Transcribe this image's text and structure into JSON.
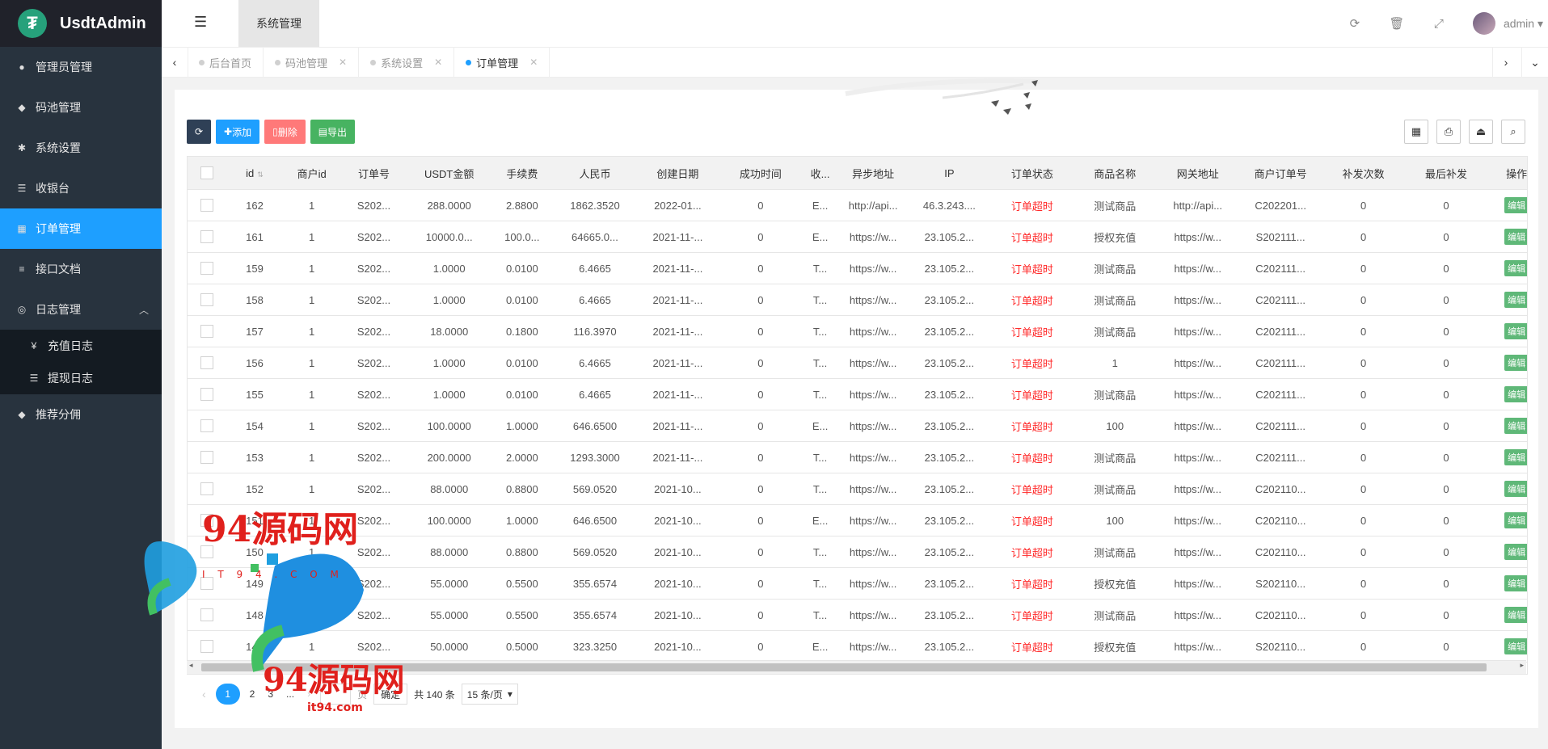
{
  "app": {
    "logo_letter": "₮",
    "title": "UsdtAdmin"
  },
  "sidebar": {
    "items": [
      {
        "label": "管理员管理",
        "icon": "user-icon"
      },
      {
        "label": "码池管理",
        "icon": "android-icon"
      },
      {
        "label": "系统设置",
        "icon": "gear-icon"
      },
      {
        "label": "收银台",
        "icon": "list-icon"
      },
      {
        "label": "订单管理",
        "icon": "calculator-icon",
        "active": true
      },
      {
        "label": "接口文档",
        "icon": "doc-icon"
      },
      {
        "label": "日志管理",
        "icon": "log-icon",
        "expanded": true
      },
      {
        "label": "推荐分佣",
        "icon": "android-icon"
      }
    ],
    "sub_items": [
      {
        "label": "充值日志",
        "glyph": "¥"
      },
      {
        "label": "提现日志",
        "glyph": "☰"
      }
    ]
  },
  "header": {
    "section_tab": "系统管理",
    "user": "admin"
  },
  "tabs": [
    {
      "label": "后台首页",
      "closable": false
    },
    {
      "label": "码池管理",
      "closable": true
    },
    {
      "label": "系统设置",
      "closable": true
    },
    {
      "label": "订单管理",
      "closable": true,
      "active": true
    }
  ],
  "toolbar": {
    "add": "添加",
    "delete": "删除",
    "export": "导出"
  },
  "table": {
    "columns": [
      "id",
      "商户id",
      "订单号",
      "USDT金额",
      "手续费",
      "人民币",
      "创建日期",
      "成功时间",
      "收...",
      "异步地址",
      "IP",
      "订单状态",
      "商品名称",
      "网关地址",
      "商户订单号",
      "补发次数",
      "最后补发",
      "操作"
    ],
    "edit_label": "编辑",
    "rows": [
      [
        "162",
        "1",
        "S202...",
        "288.0000",
        "2.8800",
        "1862.3520",
        "2022-01...",
        "0",
        "E...",
        "http://api...",
        "46.3.243....",
        "订单超时",
        "测试商品",
        "http://api...",
        "C202201...",
        "0",
        "0"
      ],
      [
        "161",
        "1",
        "S202...",
        "10000.0...",
        "100.0...",
        "64665.0...",
        "2021-11-...",
        "0",
        "E...",
        "https://w...",
        "23.105.2...",
        "订单超时",
        "授权充值",
        "https://w...",
        "S202111...",
        "0",
        "0"
      ],
      [
        "159",
        "1",
        "S202...",
        "1.0000",
        "0.0100",
        "6.4665",
        "2021-11-...",
        "0",
        "T...",
        "https://w...",
        "23.105.2...",
        "订单超时",
        "测试商品",
        "https://w...",
        "C202111...",
        "0",
        "0"
      ],
      [
        "158",
        "1",
        "S202...",
        "1.0000",
        "0.0100",
        "6.4665",
        "2021-11-...",
        "0",
        "T...",
        "https://w...",
        "23.105.2...",
        "订单超时",
        "测试商品",
        "https://w...",
        "C202111...",
        "0",
        "0"
      ],
      [
        "157",
        "1",
        "S202...",
        "18.0000",
        "0.1800",
        "116.3970",
        "2021-11-...",
        "0",
        "T...",
        "https://w...",
        "23.105.2...",
        "订单超时",
        "测试商品",
        "https://w...",
        "C202111...",
        "0",
        "0"
      ],
      [
        "156",
        "1",
        "S202...",
        "1.0000",
        "0.0100",
        "6.4665",
        "2021-11-...",
        "0",
        "T...",
        "https://w...",
        "23.105.2...",
        "订单超时",
        "1",
        "https://w...",
        "C202111...",
        "0",
        "0"
      ],
      [
        "155",
        "1",
        "S202...",
        "1.0000",
        "0.0100",
        "6.4665",
        "2021-11-...",
        "0",
        "T...",
        "https://w...",
        "23.105.2...",
        "订单超时",
        "测试商品",
        "https://w...",
        "C202111...",
        "0",
        "0"
      ],
      [
        "154",
        "1",
        "S202...",
        "100.0000",
        "1.0000",
        "646.6500",
        "2021-11-...",
        "0",
        "E...",
        "https://w...",
        "23.105.2...",
        "订单超时",
        "100",
        "https://w...",
        "C202111...",
        "0",
        "0"
      ],
      [
        "153",
        "1",
        "S202...",
        "200.0000",
        "2.0000",
        "1293.3000",
        "2021-11-...",
        "0",
        "T...",
        "https://w...",
        "23.105.2...",
        "订单超时",
        "测试商品",
        "https://w...",
        "C202111...",
        "0",
        "0"
      ],
      [
        "152",
        "1",
        "S202...",
        "88.0000",
        "0.8800",
        "569.0520",
        "2021-10...",
        "0",
        "T...",
        "https://w...",
        "23.105.2...",
        "订单超时",
        "测试商品",
        "https://w...",
        "C202110...",
        "0",
        "0"
      ],
      [
        "151",
        "1",
        "S202...",
        "100.0000",
        "1.0000",
        "646.6500",
        "2021-10...",
        "0",
        "E...",
        "https://w...",
        "23.105.2...",
        "订单超时",
        "100",
        "https://w...",
        "C202110...",
        "0",
        "0"
      ],
      [
        "150",
        "1",
        "S202...",
        "88.0000",
        "0.8800",
        "569.0520",
        "2021-10...",
        "0",
        "T...",
        "https://w...",
        "23.105.2...",
        "订单超时",
        "测试商品",
        "https://w...",
        "C202110...",
        "0",
        "0"
      ],
      [
        "149",
        "1",
        "S202...",
        "55.0000",
        "0.5500",
        "355.6574",
        "2021-10...",
        "0",
        "T...",
        "https://w...",
        "23.105.2...",
        "订单超时",
        "授权充值",
        "https://w...",
        "S202110...",
        "0",
        "0"
      ],
      [
        "148",
        "1",
        "S202...",
        "55.0000",
        "0.5500",
        "355.6574",
        "2021-10...",
        "0",
        "T...",
        "https://w...",
        "23.105.2...",
        "订单超时",
        "测试商品",
        "https://w...",
        "C202110...",
        "0",
        "0"
      ],
      [
        "147",
        "1",
        "S202...",
        "50.0000",
        "0.5000",
        "323.3250",
        "2021-10...",
        "0",
        "E...",
        "https://w...",
        "23.105.2...",
        "订单超时",
        "授权充值",
        "https://w...",
        "S202110...",
        "0",
        "0"
      ]
    ]
  },
  "pagination": {
    "current": "1",
    "pages": [
      "2",
      "3"
    ],
    "ellipsis": "...",
    "goto_unit": "页",
    "confirm": "确定",
    "total": "共 140 条",
    "page_size": "15 条/页"
  },
  "watermark": {
    "text": "94源码网",
    "domain": "it94.com",
    "arc": "I T 9 4 . C O M"
  },
  "colors": {
    "sidebar_bg": "#28333e",
    "active_blue": "#1e9fff",
    "status_red": "#ff2a2a",
    "edit_green": "#5fb878"
  }
}
